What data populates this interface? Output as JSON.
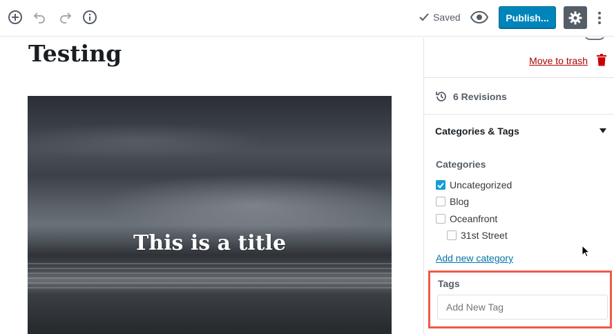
{
  "toolbar": {
    "add_block_icon": "plus-circle-icon",
    "undo_icon": "undo-icon",
    "redo_icon": "redo-icon",
    "info_icon": "info-icon",
    "saved_label": "Saved",
    "preview_icon": "eye-icon",
    "publish_label": "Publish...",
    "settings_icon": "gear-icon",
    "more_icon": "more-vertical-icon"
  },
  "editor": {
    "post_title": "Testing",
    "cover_title": "This is a title"
  },
  "sidebar": {
    "move_to_trash": "Move to trash",
    "revisions": "6 Revisions",
    "categories_tags_title": "Categories & Tags",
    "categories_label": "Categories",
    "categories": [
      {
        "label": "Uncategorized",
        "checked": true
      },
      {
        "label": "Blog",
        "checked": false
      },
      {
        "label": "Oceanfront",
        "checked": false
      },
      {
        "label": "31st Street",
        "checked": false
      }
    ],
    "add_new_category": "Add new category",
    "tags_label": "Tags",
    "tags_placeholder": "Add New Tag"
  },
  "colors": {
    "accent_blue": "#0085ba",
    "link_blue": "#0073aa",
    "trash_red": "#aa0000",
    "highlight": "#f0584b",
    "checkbox_checked": "#11a0d2"
  }
}
